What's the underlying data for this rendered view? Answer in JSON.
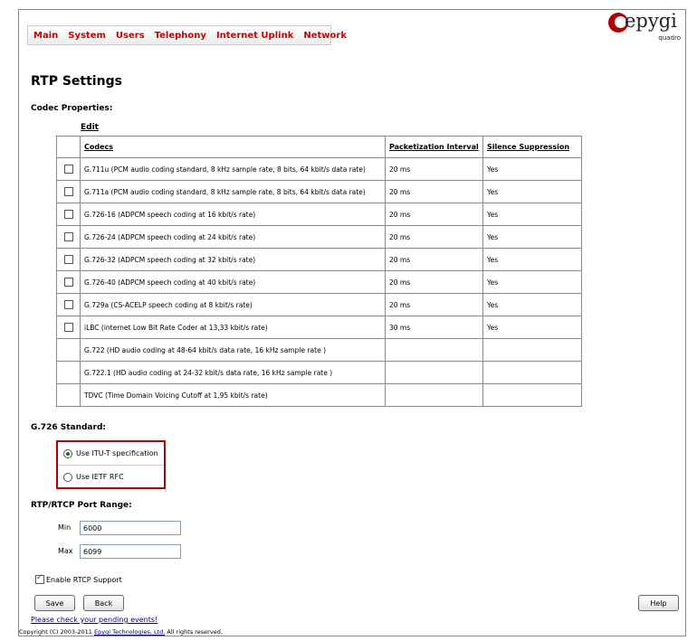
{
  "nav": {
    "items": [
      "Main",
      "System",
      "Users",
      "Telephony",
      "Internet Uplink",
      "Network"
    ]
  },
  "logo": {
    "word": "epygi",
    "sub": "quadro"
  },
  "page": {
    "title": "RTP Settings",
    "codec_heading": "Codec Properties:",
    "edit_label": "Edit"
  },
  "codec_table": {
    "headers": [
      "Codecs",
      "Packetization Interval",
      "Silence Suppression"
    ],
    "rows": [
      {
        "checkbox": true,
        "codec": "G.711u (PCM audio coding standard, 8 kHz sample rate, 8 bits, 64 kbit/s data rate)",
        "interval": "20 ms",
        "suppression": "Yes"
      },
      {
        "checkbox": true,
        "codec": "G.711a (PCM audio coding standard, 8 kHz sample rate, 8 bits, 64 kbit/s data rate)",
        "interval": "20 ms",
        "suppression": "Yes"
      },
      {
        "checkbox": true,
        "codec": "G.726-16 (ADPCM speech coding at 16 kbit/s rate)",
        "interval": "20 ms",
        "suppression": "Yes"
      },
      {
        "checkbox": true,
        "codec": "G.726-24 (ADPCM speech coding at 24 kbit/s rate)",
        "interval": "20 ms",
        "suppression": "Yes"
      },
      {
        "checkbox": true,
        "codec": "G.726-32 (ADPCM speech coding at 32 kbit/s rate)",
        "interval": "20 ms",
        "suppression": "Yes"
      },
      {
        "checkbox": true,
        "codec": "G.726-40 (ADPCM speech coding at 40 kbit/s rate)",
        "interval": "20 ms",
        "suppression": "Yes"
      },
      {
        "checkbox": true,
        "codec": "G.729a (CS-ACELP speech coding at 8 kbit/s rate)",
        "interval": "20 ms",
        "suppression": "Yes"
      },
      {
        "checkbox": true,
        "codec": "iLBC (internet Low Bit Rate Coder at 13,33 kbit/s rate)",
        "interval": "30 ms",
        "suppression": "Yes"
      },
      {
        "checkbox": false,
        "codec": "G.722 (HD audio coding at 48-64 kbit/s data rate, 16 kHz sample rate )",
        "interval": "",
        "suppression": ""
      },
      {
        "checkbox": false,
        "codec": "G.722.1 (HD audio coding at 24-32 kbit/s data rate, 16 kHz sample rate )",
        "interval": "",
        "suppression": ""
      },
      {
        "checkbox": false,
        "codec": "TDVC (Time Domain Voicing Cutoff at 1,95 kbit/s rate)",
        "interval": "",
        "suppression": ""
      }
    ]
  },
  "g726": {
    "heading": "G.726 Standard:",
    "options": [
      "Use ITU-T specification",
      "Use IETF RFC"
    ],
    "selected": 0
  },
  "port_range": {
    "heading": "RTP/RTCP Port Range:",
    "min_label": "Min",
    "min_value": "6000",
    "max_label": "Max",
    "max_value": "6099"
  },
  "rtcp": {
    "label": "Enable RTCP Support",
    "checked": true
  },
  "buttons": {
    "save": "Save",
    "back": "Back",
    "help": "Help"
  },
  "footer": {
    "pending": "Please check your pending events!",
    "copyright_prefix": "Copyright (C) 2003-2011",
    "company": "Epygi Technologies, Ltd.",
    "copyright_suffix": "All rights reserved."
  }
}
